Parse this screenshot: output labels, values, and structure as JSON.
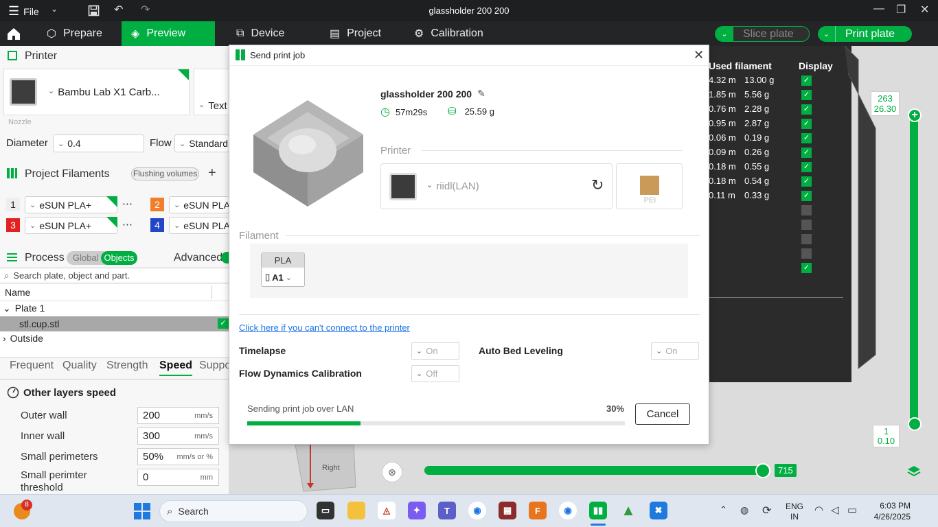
{
  "titlebar": {
    "file_label": "File",
    "title": "glassholder 200 200"
  },
  "nav": {
    "tabs": [
      {
        "label": "Prepare"
      },
      {
        "label": "Preview"
      },
      {
        "label": "Device"
      },
      {
        "label": "Project"
      },
      {
        "label": "Calibration"
      }
    ],
    "slice_label": "Slice plate",
    "print_label": "Print plate"
  },
  "left": {
    "printer_title": "Printer",
    "printer_name": "Bambu Lab X1 Carb...",
    "plate_type_partial": "Text",
    "nozzle_label": "Nozzle",
    "diameter_label": "Diameter",
    "diameter_value": "0.4",
    "flow_label": "Flow",
    "flow_value": "Standard",
    "filaments_title": "Project Filaments",
    "flushing_label": "Flushing volumes",
    "add_label": "+",
    "filaments": [
      {
        "num": "1",
        "name": "eSUN PLA+",
        "color": "#eeeeee",
        "text": "#222222"
      },
      {
        "num": "2",
        "name": "eSUN PLA+",
        "color": "#f07e2a",
        "text": "#ffffff"
      },
      {
        "num": "3",
        "name": "eSUN PLA+",
        "color": "#e32121",
        "text": "#ffffff"
      },
      {
        "num": "4",
        "name": "eSUN PLA+",
        "color": "#2146c7",
        "text": "#ffffff"
      }
    ],
    "process_title": "Process",
    "global_label": "Global",
    "objects_label": "Objects",
    "advanced_label": "Advanced",
    "search_placeholder": "Search plate, object and part.",
    "name_header": "Name",
    "tree": {
      "plate": "Plate 1",
      "object": "stl.cup.stl",
      "outside": "Outside"
    },
    "tabs": [
      "Frequent",
      "Quality",
      "Strength",
      "Speed",
      "Suppo"
    ],
    "speed_section": "Other layers speed",
    "speeds": [
      {
        "label": "Outer wall",
        "value": "200",
        "unit": "mm/s"
      },
      {
        "label": "Inner wall",
        "value": "300",
        "unit": "mm/s"
      },
      {
        "label": "Small perimeters",
        "value": "50%",
        "unit": "mm/s or %"
      },
      {
        "label": "Small perimter threshold",
        "value": "0",
        "unit": "mm"
      }
    ]
  },
  "filament_table": {
    "col_used": "Used filament",
    "col_display": "Display",
    "rows": [
      {
        "m": "4.32 m",
        "g": "13.00 g",
        "checked": true
      },
      {
        "m": "1.85 m",
        "g": "5.56 g",
        "checked": true
      },
      {
        "m": "0.76 m",
        "g": "2.28 g",
        "checked": true
      },
      {
        "m": "0.95 m",
        "g": "2.87 g",
        "checked": true
      },
      {
        "m": "0.06 m",
        "g": "0.19 g",
        "checked": true
      },
      {
        "m": "0.09 m",
        "g": "0.26 g",
        "checked": true
      },
      {
        "m": "0.18 m",
        "g": "0.55 g",
        "checked": true
      },
      {
        "m": "0.18 m",
        "g": "0.54 g",
        "checked": true
      },
      {
        "m": "0.11 m",
        "g": "0.33 g",
        "checked": true
      },
      {
        "m": "",
        "g": "",
        "checked": false
      },
      {
        "m": "",
        "g": "",
        "checked": false
      },
      {
        "m": "",
        "g": "",
        "checked": false
      },
      {
        "m": "",
        "g": "",
        "checked": false
      },
      {
        "m": "",
        "g": "",
        "checked": true
      }
    ]
  },
  "layer_slider": {
    "top_layer": "263",
    "top_height": "26.30",
    "bottom_layer": "1",
    "bottom_height": "0.10",
    "move_value": "715",
    "move_fraction": 1.0
  },
  "cube_label": "Right",
  "dialog": {
    "title": "Send print job",
    "model_name": "glassholder 200 200",
    "time": "57m29s",
    "weight": "25.59 g",
    "printer_section": "Printer",
    "printer_name": "riidl(LAN)",
    "plate_label": "PEI",
    "filament_section": "Filament",
    "filament_type": "PLA",
    "filament_slot": "A1",
    "help_link": "Click here if you can't connect to the printer",
    "options": [
      {
        "label": "Timelapse",
        "value": "On"
      },
      {
        "label": "Auto Bed Leveling",
        "value": "On"
      },
      {
        "label": "Flow Dynamics Calibration",
        "value": "Off"
      }
    ],
    "progress_text": "Sending print job over LAN",
    "progress_percent": "30%",
    "progress_fraction": 0.3,
    "cancel_label": "Cancel"
  },
  "taskbar": {
    "search_placeholder": "Search",
    "notification_count": "8",
    "lang": "ENG",
    "region": "IN",
    "time": "6:03 PM",
    "date": "4/26/2025"
  },
  "colors": {
    "accent": "#00ae42",
    "dark": "#232526"
  }
}
